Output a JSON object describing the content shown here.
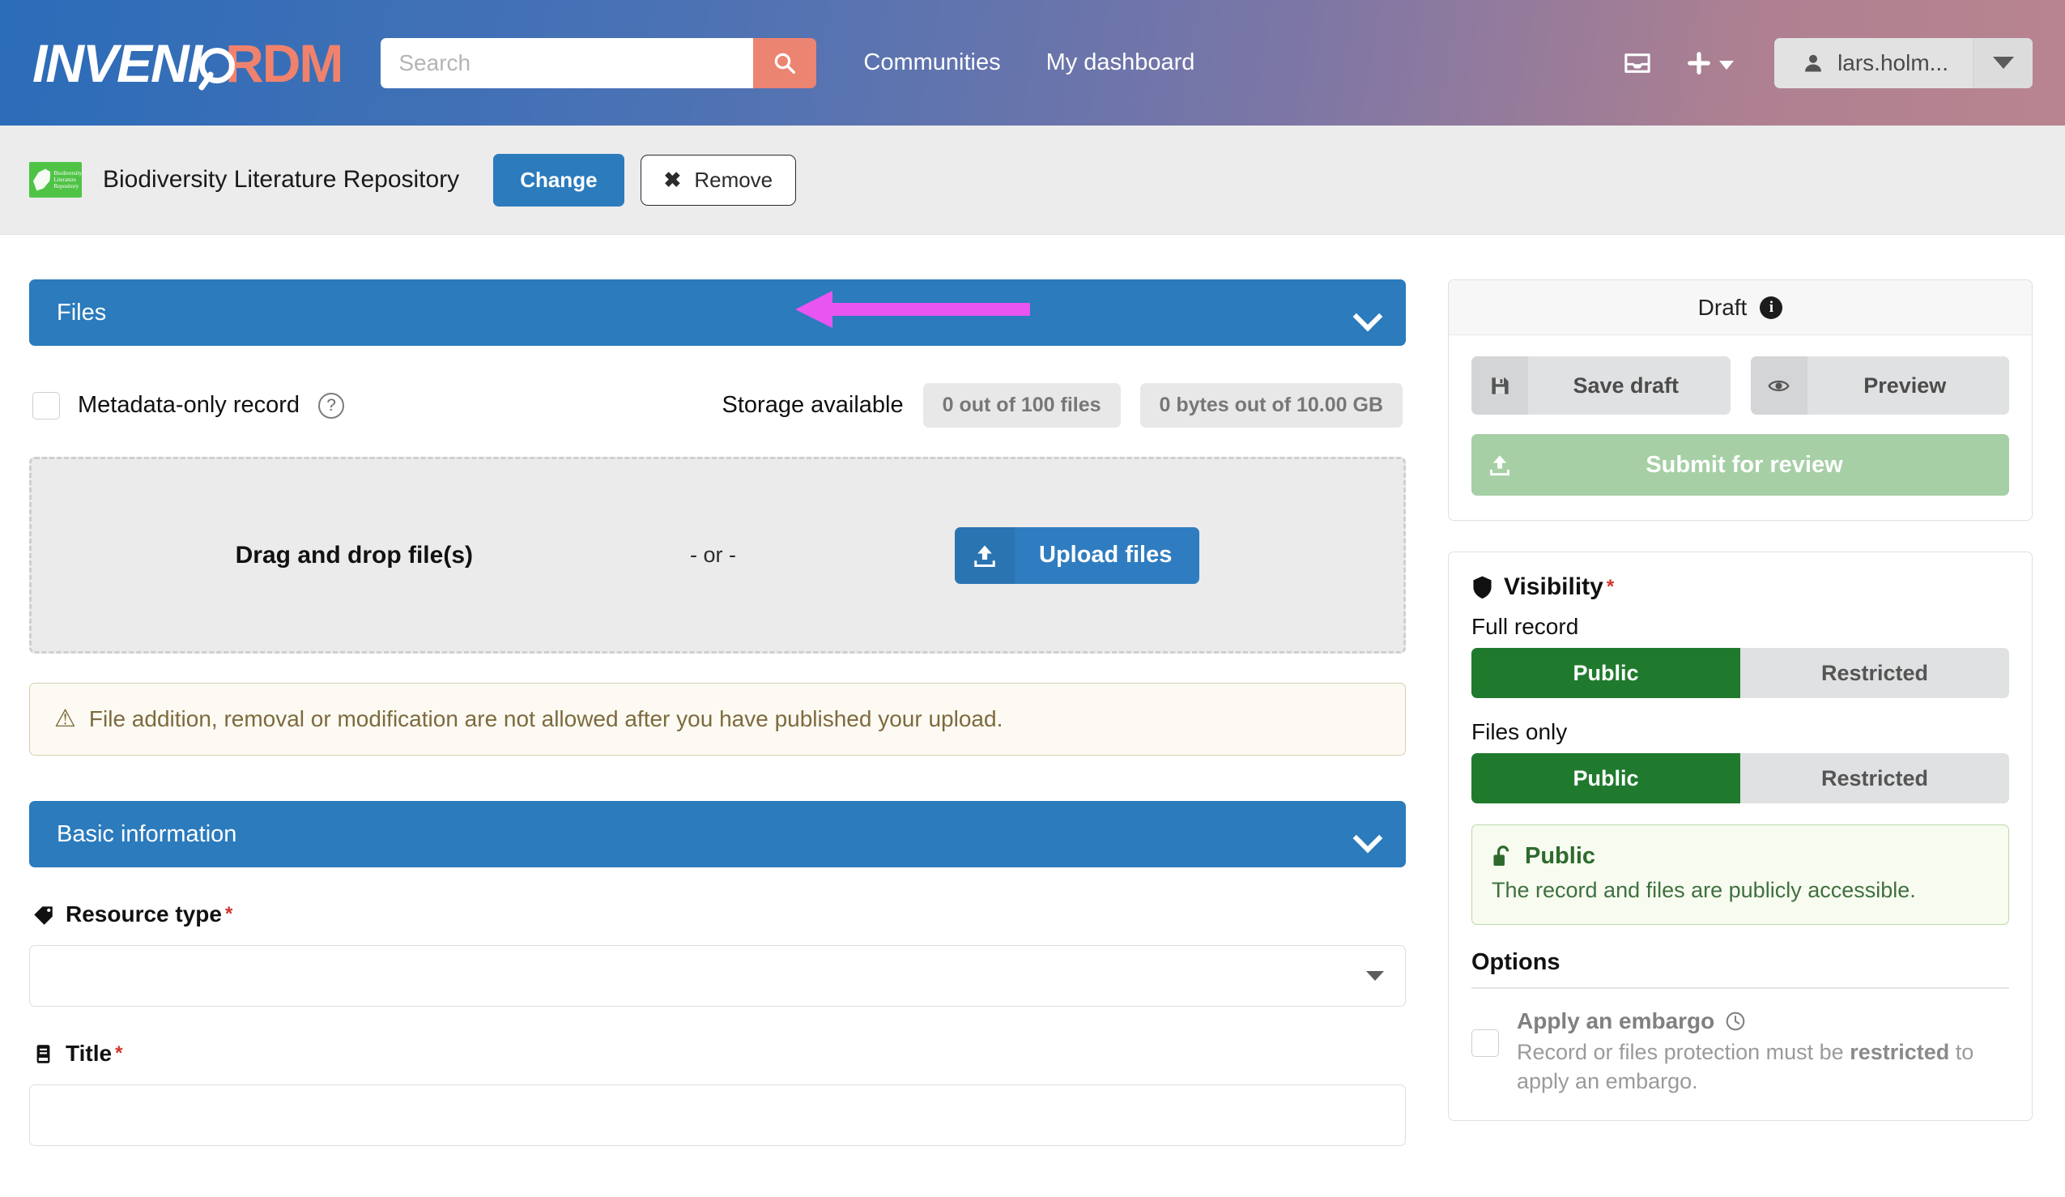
{
  "header": {
    "brand": {
      "part1": "INVEN",
      "part2": "I",
      "part3": "RDM"
    },
    "search": {
      "placeholder": "Search",
      "value": "",
      "icon": "search-icon"
    },
    "nav": [
      {
        "label": "Communities"
      },
      {
        "label": "My dashboard"
      }
    ],
    "inbox_icon": "inbox-icon",
    "plus_icon": "plus-icon",
    "user": {
      "name": "lars.holm...",
      "avatar_icon": "user-icon",
      "caret_icon": "chevron-down-icon"
    }
  },
  "community_bar": {
    "logo_alt": "Biodiversity Literature Repository",
    "logo_text": "Biodiversity Literature Repository",
    "name": "Biodiversity Literature Repository",
    "change_label": "Change",
    "remove_label": "Remove",
    "remove_icon": "x-icon",
    "annotation_color": "#e855f0"
  },
  "files_section": {
    "title": "Files",
    "collapse_icon": "chevron-down-icon",
    "metadata_only_label": "Metadata-only record",
    "help_icon": "question-circle-icon",
    "storage_label": "Storage available",
    "storage_files": "0 out of 100 files",
    "storage_bytes": "0 bytes out of 10.00 GB",
    "dropzone_text": "Drag and drop file(s)",
    "dropzone_or": "- or -",
    "upload_label": "Upload files",
    "upload_icon": "upload-icon",
    "warning_icon": "warning-icon",
    "warning_text": "File addition, removal or modification are not allowed after you have published your upload."
  },
  "basic_information": {
    "title": "Basic information",
    "collapse_icon": "chevron-down-icon",
    "resource_type_label": "Resource type",
    "resource_type_icon": "tag-icon",
    "resource_type_value": "",
    "title_label": "Title",
    "title_icon": "book-icon",
    "title_value": "",
    "required_marker": "*"
  },
  "sidebar": {
    "draft": {
      "header": "Draft",
      "info_icon": "info-icon",
      "info_glyph": "i",
      "save_draft_label": "Save draft",
      "save_draft_icon": "save-icon",
      "preview_label": "Preview",
      "preview_icon": "eye-icon",
      "submit_label": "Submit for review",
      "submit_icon": "upload-icon"
    },
    "visibility": {
      "title": "Visibility",
      "shield_icon": "shield-icon",
      "required_marker": "*",
      "full_record_label": "Full record",
      "files_only_label": "Files only",
      "options": {
        "public": "Public",
        "restricted": "Restricted"
      },
      "full_record_selected": "Public",
      "files_only_selected": "Public",
      "notice_title": "Public",
      "notice_icon": "unlock-icon",
      "notice_text": "The record and files are publicly accessible.",
      "options_title": "Options",
      "embargo_label": "Apply an embargo",
      "embargo_icon": "clock-icon",
      "embargo_desc_pre": "Record or files protection must be ",
      "embargo_desc_bold": "restricted",
      "embargo_desc_post": " to apply an embargo.",
      "accent_green": "#1f7a2e"
    }
  }
}
